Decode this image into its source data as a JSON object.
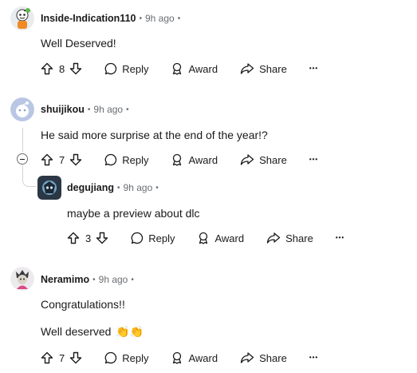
{
  "comments": [
    {
      "username": "Inside-Indication110",
      "time": "9h ago",
      "body": "Well Deserved!",
      "votes": "8",
      "reply_label": "Reply",
      "award_label": "Award",
      "share_label": "Share",
      "more_label": "•••",
      "avatar_color": "#f5f5f5"
    },
    {
      "username": "shuijikou",
      "time": "9h ago",
      "body": "He said more surprise at the end of the year!?",
      "votes": "7",
      "reply_label": "Reply",
      "award_label": "Award",
      "share_label": "Share",
      "more_label": "•••",
      "avatar_color": "#b8c5e0"
    },
    {
      "username": "degujiang",
      "time": "9h ago",
      "body": "maybe a preview about dlc",
      "votes": "3",
      "reply_label": "Reply",
      "award_label": "Award",
      "share_label": "Share",
      "more_label": "•••",
      "avatar_color": "#2f3a45"
    },
    {
      "username": "Neramimo",
      "time": "9h ago",
      "body": "Congratulations!!",
      "body2": "Well deserved",
      "emoji": "👏👏",
      "votes": "7",
      "reply_label": "Reply",
      "award_label": "Award",
      "share_label": "Share",
      "more_label": "•••",
      "avatar_color": "#e8e2e6"
    }
  ],
  "dot": "•"
}
